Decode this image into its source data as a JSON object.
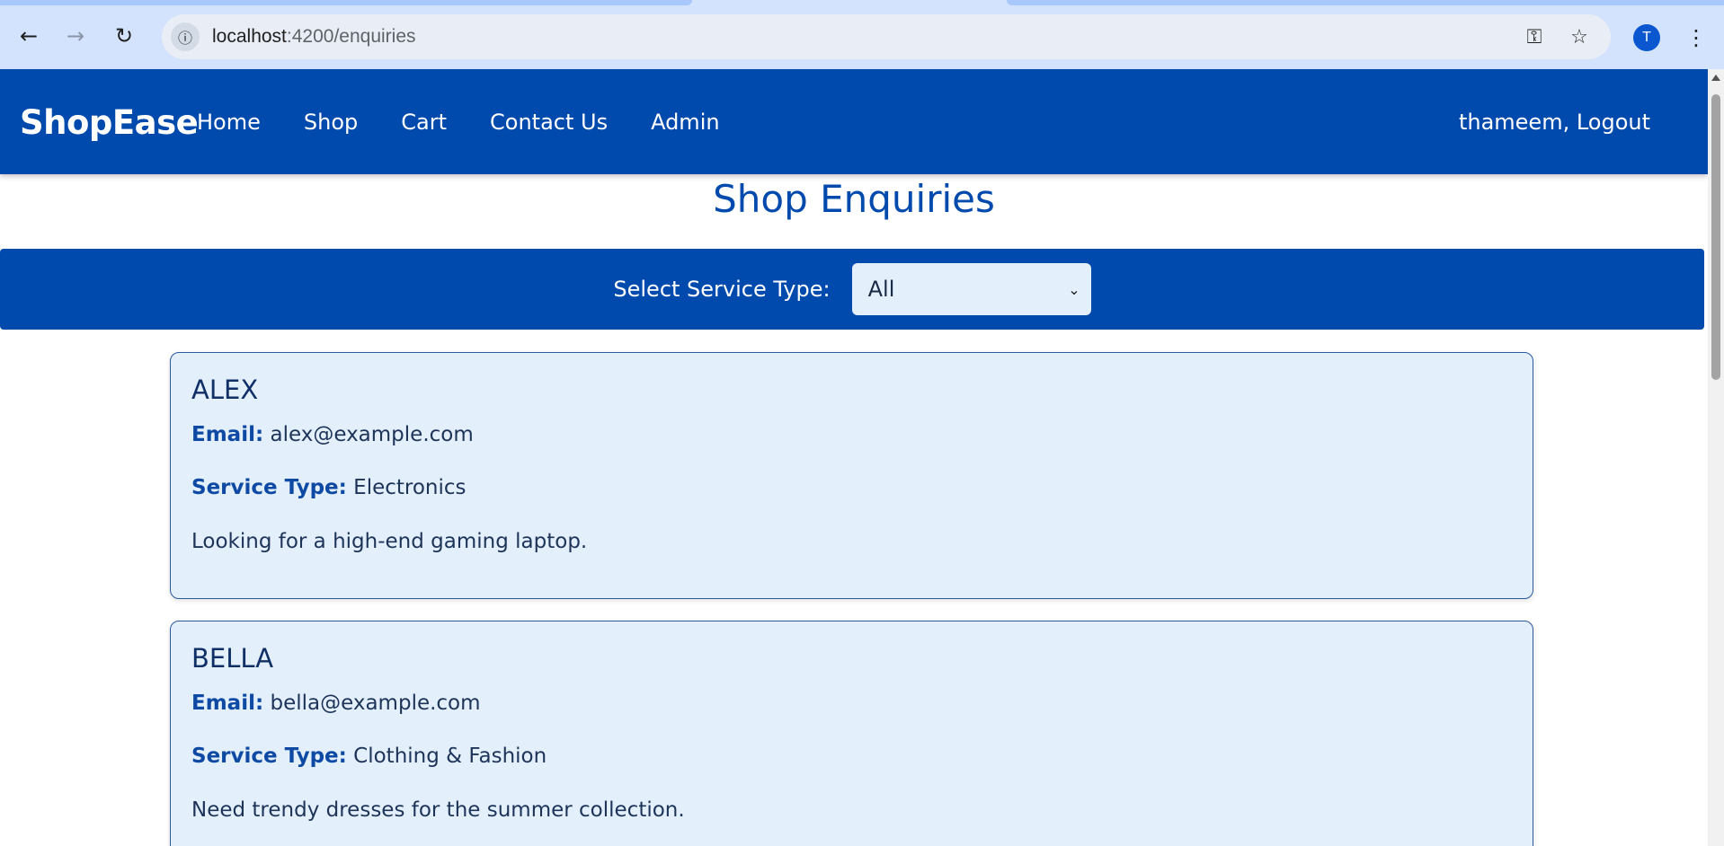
{
  "browser": {
    "url_host": "localhost",
    "url_path": ":4200/enquiries",
    "profile_initial": "T"
  },
  "navbar": {
    "brand": "ShopEase",
    "links": [
      "Home",
      "Shop",
      "Cart",
      "Contact Us",
      "Admin"
    ],
    "user_logout": "thameem, Logout"
  },
  "page": {
    "title": "Shop Enquiries"
  },
  "filter": {
    "label": "Select Service Type:",
    "selected": "All"
  },
  "enquiries": [
    {
      "name": "ALEX",
      "email_label": "Email:",
      "email": "alex@example.com",
      "service_label": "Service Type:",
      "service": "Electronics",
      "message": "Looking for a high-end gaming laptop."
    },
    {
      "name": "BELLA",
      "email_label": "Email:",
      "email": "bella@example.com",
      "service_label": "Service Type:",
      "service": "Clothing & Fashion",
      "message": "Need trendy dresses for the summer collection."
    }
  ]
}
